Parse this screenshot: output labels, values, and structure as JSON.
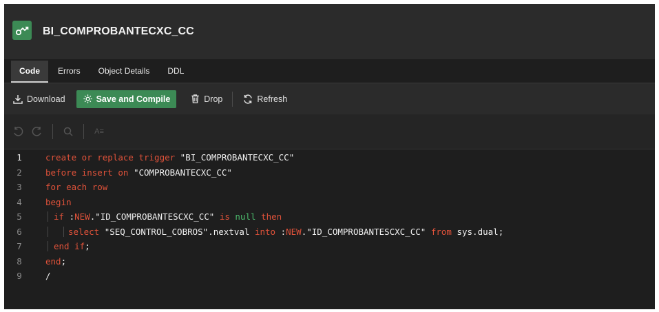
{
  "object": {
    "title": "BI_COMPROBANTECXC_CC",
    "icon": "trigger-icon"
  },
  "tabs": [
    {
      "label": "Code",
      "active": true
    },
    {
      "label": "Errors",
      "active": false
    },
    {
      "label": "Object Details",
      "active": false
    },
    {
      "label": "DDL",
      "active": false
    }
  ],
  "toolbar": {
    "download": "Download",
    "save_compile": "Save and Compile",
    "drop": "Drop",
    "refresh": "Refresh"
  },
  "editor_tools": [
    "undo-icon",
    "redo-icon",
    "search-icon",
    "format-icon"
  ],
  "editor_tools_label": "A≡",
  "code_lines": [
    "1",
    "2",
    "3",
    "4",
    "5",
    "6",
    "7",
    "8",
    "9"
  ],
  "code": {
    "l1": [
      [
        "kw",
        "create or replace trigger "
      ],
      [
        "str",
        "\"BI_COMPROBANTECXC_CC\""
      ]
    ],
    "l2": [
      [
        "kw",
        "before insert on "
      ],
      [
        "str",
        "\"COMPROBANTECXC_CC\""
      ]
    ],
    "l3": [
      [
        "kw",
        "for each row"
      ]
    ],
    "l4": [
      [
        "kw",
        "begin"
      ]
    ],
    "l5": [
      [
        "kw",
        "if "
      ],
      [
        "str",
        ":"
      ],
      [
        "kw",
        "NEW"
      ],
      [
        "str",
        ".\"ID_COMPROBANTESCXC_CC\" "
      ],
      [
        "kw",
        "is "
      ],
      [
        "nul",
        "null "
      ],
      [
        "kw",
        "then"
      ]
    ],
    "l6": [
      [
        "kw",
        "select "
      ],
      [
        "str",
        "\"SEQ_CONTROL_COBROS\".nextval "
      ],
      [
        "kw",
        "into "
      ],
      [
        "str",
        ":"
      ],
      [
        "kw",
        "NEW"
      ],
      [
        "str",
        ".\"ID_COMPROBANTESCXC_CC\" "
      ],
      [
        "kw",
        "from "
      ],
      [
        "str",
        "sys.dual;"
      ]
    ],
    "l7": [
      [
        "kw",
        "end if"
      ],
      [
        "str",
        ";"
      ]
    ],
    "l8": [
      [
        "kw",
        "end"
      ],
      [
        "str",
        ";"
      ]
    ],
    "l9": [
      [
        "str",
        "/"
      ]
    ]
  },
  "colors": {
    "accent": "#3c8a55",
    "keyword": "#e0523a",
    "null_kw": "#4cbb6d",
    "background": "#1e1e1e"
  }
}
